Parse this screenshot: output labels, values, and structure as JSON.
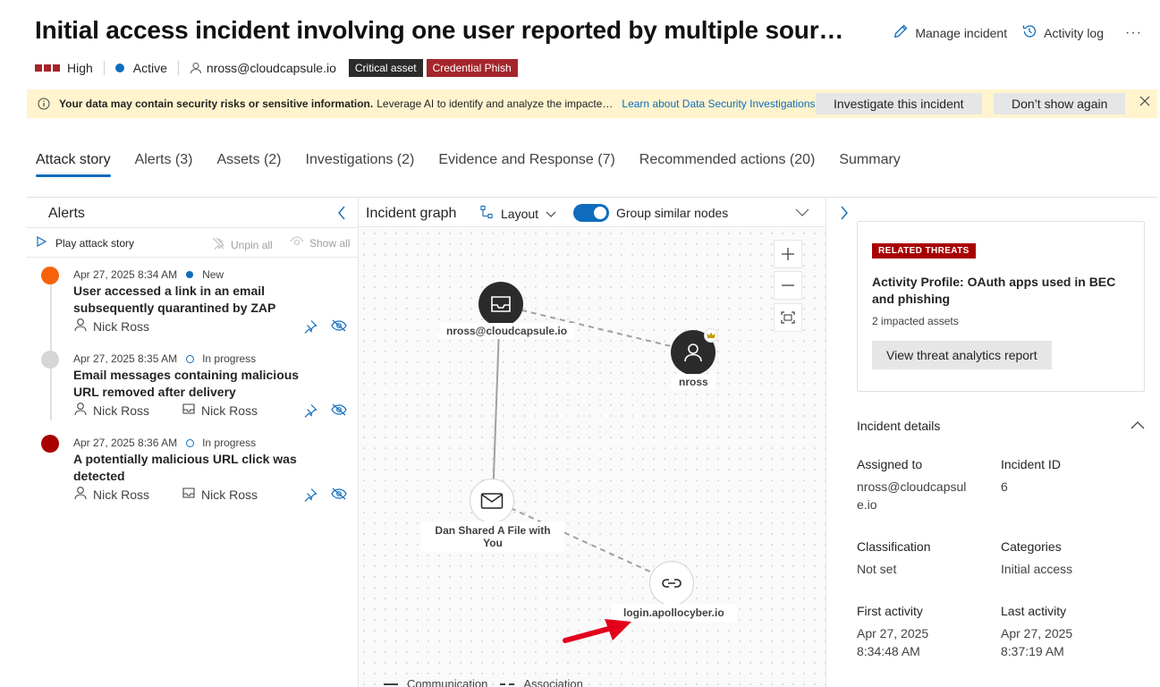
{
  "header": {
    "title": "Initial access incident involving one user reported by multiple sour…",
    "manage_incident": "Manage incident",
    "activity_log": "Activity log",
    "more": "···"
  },
  "meta": {
    "severity": "High",
    "status": "Active",
    "user": "nross@cloudcapsule.io",
    "tags": [
      "Critical asset",
      "Credential Phish"
    ]
  },
  "banner": {
    "strong": "Your data may contain security risks or sensitive information.",
    "text": "Leverage AI to identify and analyze the impacte…",
    "link": "Learn about Data Security Investigations",
    "investigate_btn": "Investigate this incident",
    "dismiss_btn": "Don’t show again"
  },
  "tabs": [
    {
      "label": "Attack story",
      "active": true
    },
    {
      "label": "Alerts (3)"
    },
    {
      "label": "Assets (2)"
    },
    {
      "label": "Investigations (2)"
    },
    {
      "label": "Evidence and Response (7)"
    },
    {
      "label": "Recommended actions (20)"
    },
    {
      "label": "Summary"
    }
  ],
  "alerts_panel": {
    "title": "Alerts",
    "play": "Play attack story",
    "unpin_all": "Unpin all",
    "show_all": "Show all",
    "alerts": [
      {
        "time": "Apr 27, 2025 8:34 AM",
        "status": "New",
        "name": "User accessed a link in an email subsequently quarantined by ZAP",
        "user": "Nick Ross",
        "device": "",
        "color": "#f7630c"
      },
      {
        "time": "Apr 27, 2025 8:35 AM",
        "status": "In progress",
        "name": "Email messages containing malicious URL removed after delivery",
        "user": "Nick Ross",
        "device": "Nick Ross",
        "color": "#d6d6d6"
      },
      {
        "time": "Apr 27, 2025 8:36 AM",
        "status": "In progress",
        "name": "A potentially malicious URL click was detected",
        "user": "Nick Ross",
        "device": "Nick Ross",
        "color": "#a80000"
      }
    ]
  },
  "graph": {
    "title": "Incident graph",
    "layout": "Layout",
    "group_toggle": "Group similar nodes",
    "nodes": {
      "mailbox": "nross@cloudcapsule.io",
      "user": "nross",
      "email": "Dan Shared A File with You",
      "url": "login.apollocyber.io"
    },
    "legend": {
      "communication": "Communication",
      "association": "Association"
    }
  },
  "threats": {
    "badge": "RELATED THREATS",
    "title": "Activity Profile: OAuth apps used in BEC and phishing",
    "sub": "2 impacted assets",
    "button": "View threat analytics report"
  },
  "details": {
    "header": "Incident details",
    "assigned_to_label": "Assigned to",
    "assigned_to": "nross@cloudcapsule.io",
    "incident_id_label": "Incident ID",
    "incident_id": "6",
    "classification_label": "Classification",
    "classification": "Not set",
    "categories_label": "Categories",
    "categories": "Initial access",
    "first_activity_label": "First activity",
    "first_activity": "Apr 27, 2025 8:34:48 AM",
    "last_activity_label": "Last activity",
    "last_activity": "Apr 27, 2025 8:37:19 AM"
  },
  "colors": {
    "accent": "#0f6cbd",
    "severity_high": "#a4262c",
    "banner_bg": "#fff4ce",
    "annotation_arrow": "#e3001b"
  }
}
